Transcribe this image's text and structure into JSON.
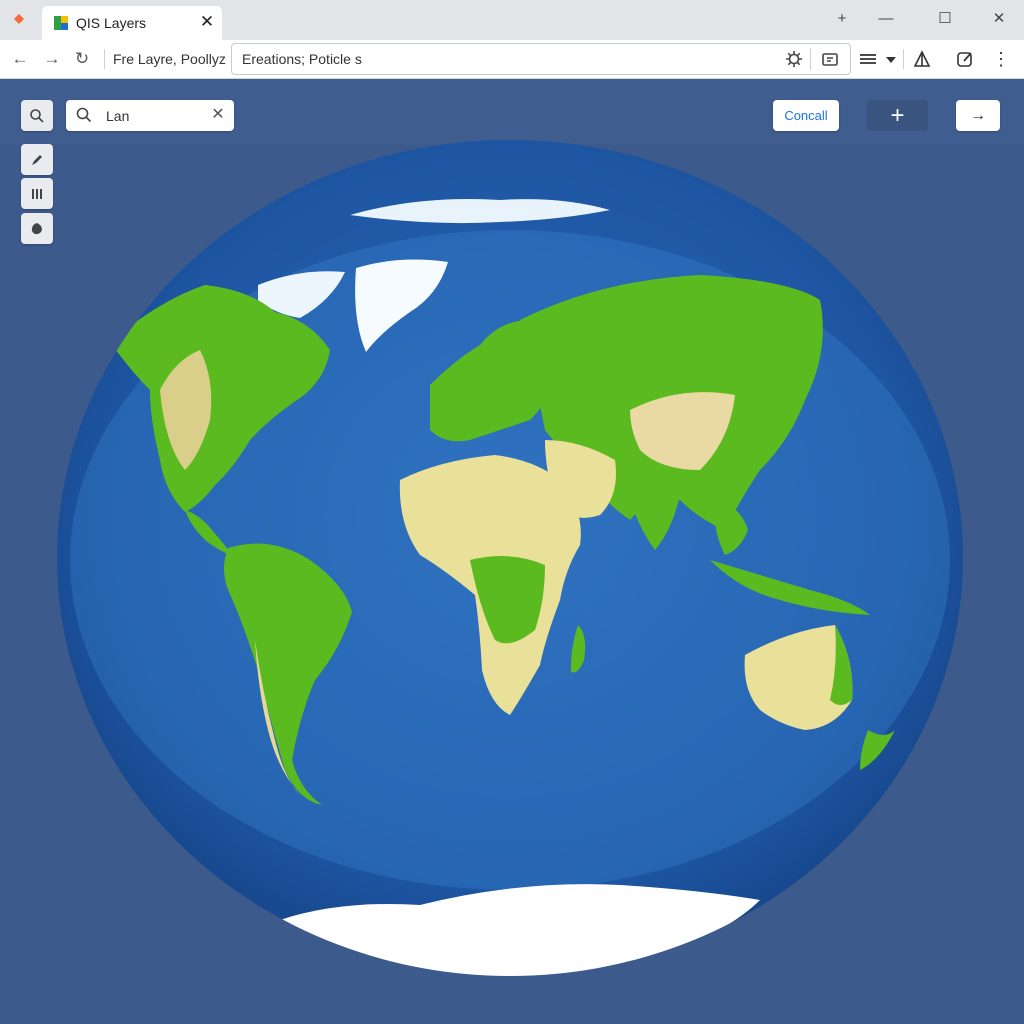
{
  "window": {
    "tab_title": "QIS Layers",
    "tab_close": "✕",
    "buttons": {
      "pin": "+",
      "minimize": "—",
      "maximize": "☐",
      "close": "✕"
    }
  },
  "nav": {
    "back": "←",
    "forward": "→",
    "reload": "↻",
    "layer_label": "Fre Layre, Poollyz",
    "address_value": "Ereations; Poticle s",
    "tools": [
      "settings-icon",
      "tray-icon",
      "list-icon",
      "dropdown-icon",
      "measure-icon",
      "edit-icon",
      "more-icon"
    ],
    "more": "⋮"
  },
  "map": {
    "search_value": "Lan",
    "search_clear": "✕",
    "cancel_label": "Concall",
    "add_label": "+",
    "next_label": "→",
    "tools": [
      "brush-icon",
      "grid-icon",
      "shape-icon"
    ],
    "colors": {
      "background": "#3d5a8c",
      "ocean": "#1e56a3",
      "land": "#5cba21",
      "desert": "#e9e09a",
      "ice": "#ffffff"
    }
  }
}
